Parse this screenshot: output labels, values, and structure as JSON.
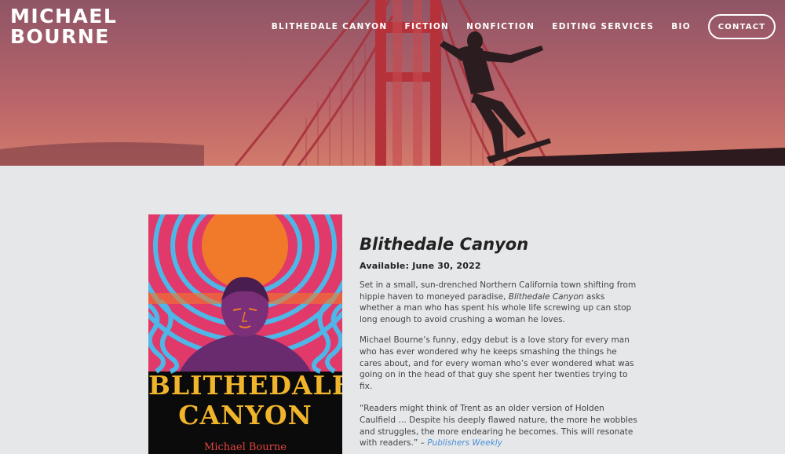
{
  "site": {
    "title_line1": "MICHAEL",
    "title_line2": "BOURNE"
  },
  "nav": {
    "items": [
      {
        "label": "BLITHEDALE CANYON"
      },
      {
        "label": "FICTION"
      },
      {
        "label": "NONFICTION"
      },
      {
        "label": "EDITING SERVICES"
      },
      {
        "label": "BIO"
      }
    ],
    "contact_label": "CONTACT"
  },
  "hero": {
    "image": "golden-gate-bridge-skateboarder",
    "colors": {
      "sky_top": "#9a5a66",
      "sky_bottom": "#c9706a",
      "bridge": "#b8333a"
    }
  },
  "book": {
    "cover": {
      "title_line1": "BLITHEDALE",
      "title_line2": "CANYON",
      "author": "Michael Bourne"
    },
    "title": "Blithedale Canyon",
    "available": "Available: June 30, 2022",
    "desc1_before": "Set in a small, sun-drenched Northern California town shifting from hippie haven to moneyed paradise, ",
    "desc1_em": "Blithedale Canyon",
    "desc1_after": " asks whether a man who has spent his whole life screwing up can stop long enough to avoid crushing a woman he loves.",
    "desc2": "Michael Bourne’s funny, edgy debut is a love story for every man who has ever wondered why he keeps smashing the things he cares about, and for every woman who’s ever wondered what was going on in the head of that guy she spent her twenties trying to fix.",
    "quote_text": "“Readers might think of Trent as an older version of Holden Caulfield … Despite his deeply flawed nature, the more he wobbles and struggles, the more endearing he becomes. This will resonate with readers.” – ",
    "quote_source": "Publishers Weekly"
  }
}
